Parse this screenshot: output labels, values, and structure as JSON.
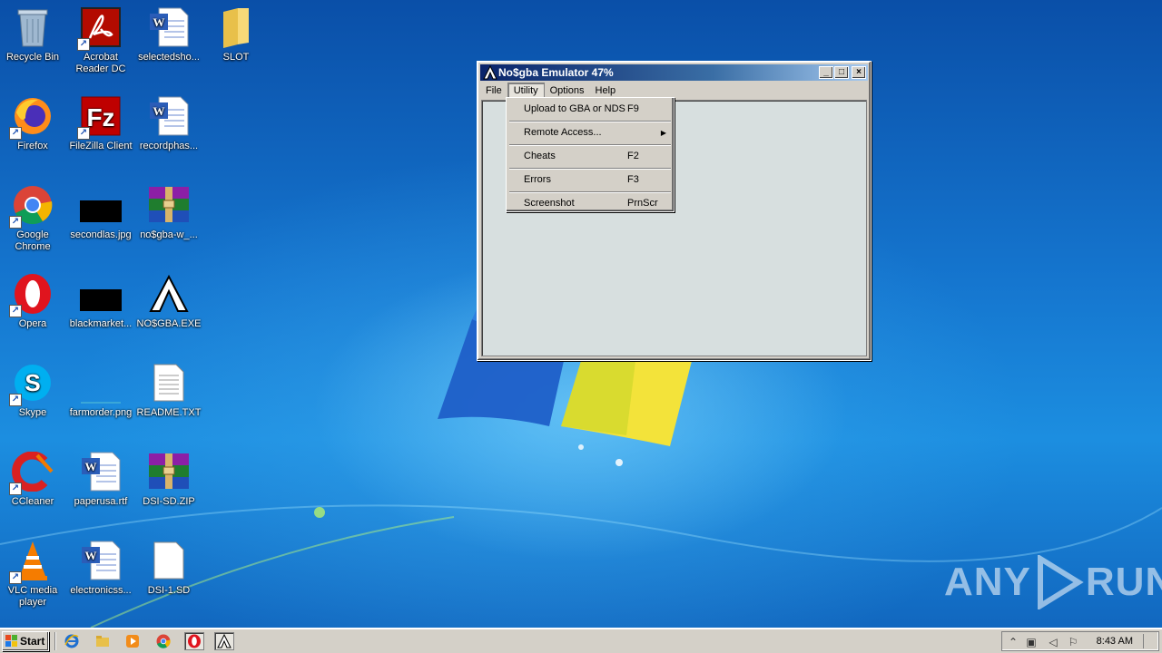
{
  "desktop": {
    "icons": [
      {
        "label": "Recycle Bin",
        "icon": "recycle-bin-icon"
      },
      {
        "label": "Acrobat Reader DC",
        "icon": "acrobat-icon"
      },
      {
        "label": "selectedsho...",
        "icon": "word-doc-icon"
      },
      {
        "label": "SLOT",
        "icon": "folder-icon"
      },
      {
        "label": "Firefox",
        "icon": "firefox-icon"
      },
      {
        "label": "FileZilla Client",
        "icon": "filezilla-icon"
      },
      {
        "label": "recordphas...",
        "icon": "word-doc-icon"
      },
      {
        "label": "Google Chrome",
        "icon": "chrome-icon"
      },
      {
        "label": "secondlas.jpg",
        "icon": "image-file-icon"
      },
      {
        "label": "no$gba-w_...",
        "icon": "winrar-icon"
      },
      {
        "label": "Opera",
        "icon": "opera-icon"
      },
      {
        "label": "blackmarket...",
        "icon": "image-file-icon"
      },
      {
        "label": "NO$GBA.EXE",
        "icon": "nogba-icon"
      },
      {
        "label": "Skype",
        "icon": "skype-icon"
      },
      {
        "label": "farmorder.png",
        "icon": "image-file-icon"
      },
      {
        "label": "README.TXT",
        "icon": "text-file-icon"
      },
      {
        "label": "CCleaner",
        "icon": "ccleaner-icon"
      },
      {
        "label": "paperusa.rtf",
        "icon": "word-doc-icon"
      },
      {
        "label": "DSI-SD.ZIP",
        "icon": "winrar-icon"
      },
      {
        "label": "VLC media player",
        "icon": "vlc-icon"
      },
      {
        "label": "electronicss...",
        "icon": "word-doc-icon"
      },
      {
        "label": "DSI-1.SD",
        "icon": "blank-file-icon"
      }
    ]
  },
  "window": {
    "title": "No$gba Emulator 47%",
    "controls": {
      "minimize": "_",
      "maximize": "□",
      "close": "×"
    },
    "menu": [
      "File",
      "Utility",
      "Options",
      "Help"
    ],
    "active_menu": "Utility"
  },
  "dropdown": {
    "items": [
      {
        "label": "Upload to GBA or NDS",
        "shortcut": "F9"
      },
      {
        "label": "Remote Access...",
        "shortcut": "",
        "submenu": true
      },
      {
        "label": "Cheats",
        "shortcut": "F2"
      },
      {
        "label": "Errors",
        "shortcut": "F3"
      },
      {
        "label": "Screenshot",
        "shortcut": "PrnScr"
      }
    ]
  },
  "watermark": {
    "left": "ANY",
    "right": "RUN"
  },
  "taskbar": {
    "start_label": "Start",
    "clock": "8:43 AM",
    "pinned": [
      "ie-icon",
      "explorer-icon",
      "media-player-icon",
      "chrome-icon",
      "opera-icon",
      "nogba-icon"
    ]
  },
  "colors": {
    "titlebar_start": "#0a246a",
    "titlebar_end": "#a6caf0",
    "window_face": "#d4d0c8",
    "client_bg": "#d7dfdf"
  }
}
